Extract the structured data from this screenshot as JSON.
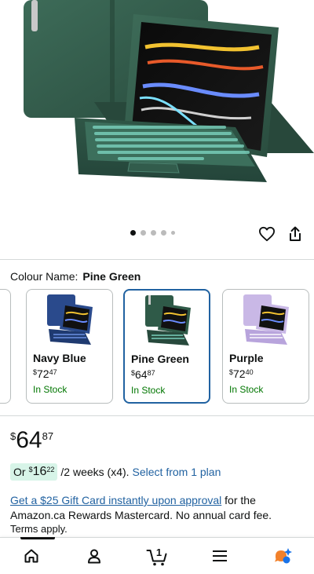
{
  "carousel": {
    "image_count": 5,
    "active_index": 0
  },
  "colour": {
    "label": "Colour Name:",
    "value": "Pine Green"
  },
  "swatches": [
    {
      "name": "Navy Blue",
      "currency": "$",
      "whole": "72",
      "cents": "47",
      "stock": "In Stock",
      "color": "#2a4a8c"
    },
    {
      "name": "Pine Green",
      "currency": "$",
      "whole": "64",
      "cents": "87",
      "stock": "In Stock",
      "color": "#2f5a48",
      "selected": true
    },
    {
      "name": "Purple",
      "currency": "$",
      "whole": "72",
      "cents": "40",
      "stock": "In Stock",
      "color": "#c9b8e6"
    }
  ],
  "price": {
    "currency": "$",
    "whole": "64",
    "cents": "87"
  },
  "plan": {
    "or": "Or",
    "currency": "$",
    "whole": "16",
    "cents": "22",
    "per": "/2 weeks (x4).",
    "link": "Select from 1 plan"
  },
  "promo": {
    "link": "Get a $25 Gift Card instantly upon approval",
    "text": " for the Amazon.ca Rewards Mastercard. No annual card fee."
  },
  "terms": "Terms apply.",
  "nav": {
    "cart_count": "1"
  },
  "colors": {
    "accent_link": "#2162a1",
    "stock_green": "#007600",
    "plan_pill": "#d7f4e8",
    "product_green": "#2f5a48"
  }
}
